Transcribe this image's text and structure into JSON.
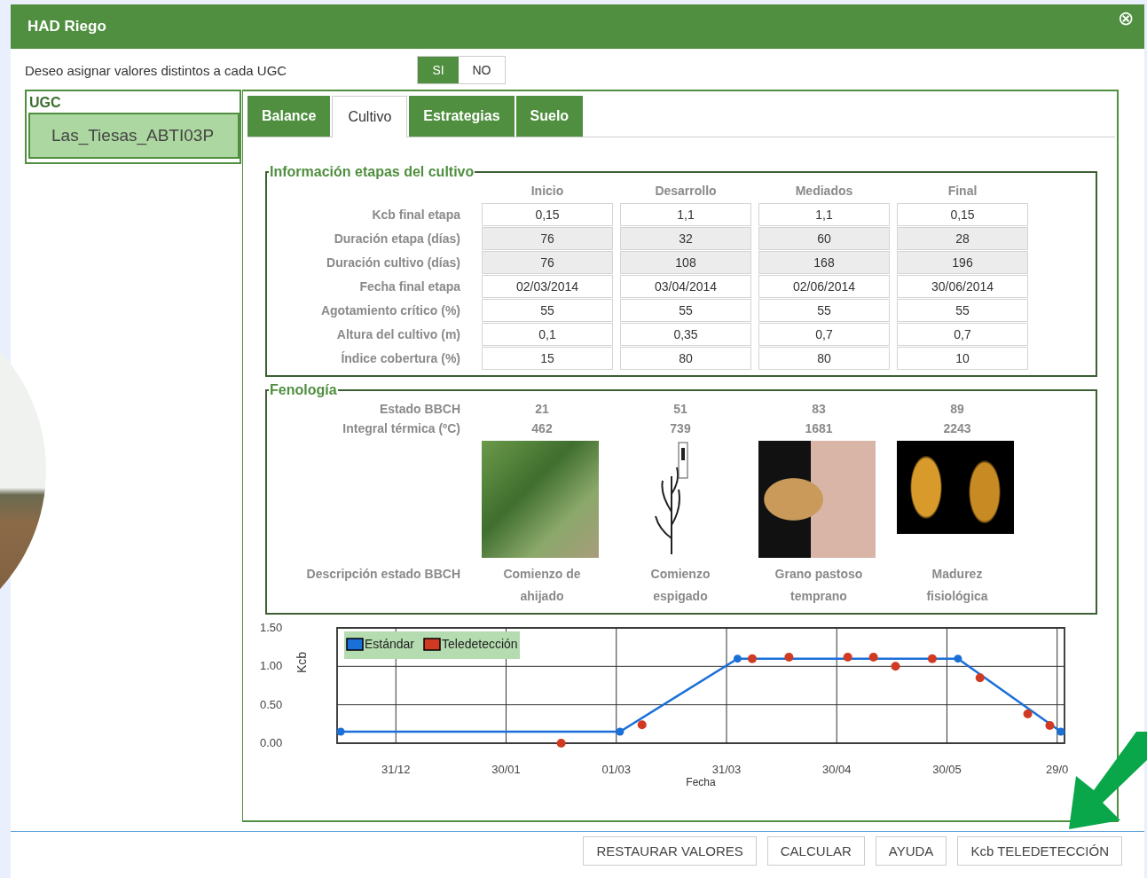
{
  "window": {
    "title": "HAD Riego",
    "close": "⊗"
  },
  "assign": {
    "label": "Deseo asignar valores distintos a cada UGC",
    "options": [
      {
        "label": "SI",
        "selected": true
      },
      {
        "label": "NO",
        "selected": false
      }
    ]
  },
  "ugc": {
    "title": "UGC",
    "items": [
      {
        "label": "Las_Tiesas_ABTI03P",
        "selected": true
      }
    ]
  },
  "tabs": [
    {
      "label": "Balance",
      "selected": false
    },
    {
      "label": "Cultivo",
      "selected": true
    },
    {
      "label": "Estrategias",
      "selected": false
    },
    {
      "label": "Suelo",
      "selected": false
    }
  ],
  "stages": {
    "title": "Información etapas del cultivo",
    "columns": [
      "Inicio",
      "Desarrollo",
      "Mediados",
      "Final"
    ],
    "rows": [
      {
        "label": "Kcb final etapa",
        "disabled": false,
        "values": [
          "0,15",
          "1,1",
          "1,1",
          "0,15"
        ]
      },
      {
        "label": "Duración etapa (días)",
        "disabled": true,
        "values": [
          "76",
          "32",
          "60",
          "28"
        ]
      },
      {
        "label": "Duración cultivo (días)",
        "disabled": true,
        "values": [
          "76",
          "108",
          "168",
          "196"
        ]
      },
      {
        "label": "Fecha final etapa",
        "disabled": false,
        "values": [
          "02/03/2014",
          "03/04/2014",
          "02/06/2014",
          "30/06/2014"
        ]
      },
      {
        "label": "Agotamiento crítico (%)",
        "disabled": false,
        "values": [
          "55",
          "55",
          "55",
          "55"
        ]
      },
      {
        "label": "Altura del cultivo (m)",
        "disabled": false,
        "values": [
          "0,1",
          "0,35",
          "0,7",
          "0,7"
        ]
      },
      {
        "label": "Índice cobertura (%)",
        "disabled": false,
        "values": [
          "15",
          "80",
          "80",
          "10"
        ]
      }
    ]
  },
  "phenology": {
    "title": "Fenología",
    "bbch_label": "Estado BBCH",
    "thermal_label": "Integral térmica (ºC)",
    "description_label": "Descripción estado BBCH",
    "stages": [
      {
        "bbch": "21",
        "thermal": "462",
        "kind": "grass",
        "description": "Comienzo de ahijado"
      },
      {
        "bbch": "51",
        "thermal": "739",
        "kind": "plant",
        "description": "Comienzo espigado"
      },
      {
        "bbch": "83",
        "thermal": "1681",
        "kind": "grain-closeup",
        "description": "Grano pastoso temprano"
      },
      {
        "bbch": "89",
        "thermal": "2243",
        "kind": "grains",
        "description": "Madurez fisiológica"
      }
    ]
  },
  "chart": {
    "chart_data": {
      "type": "line",
      "grid": true,
      "legend": "upper left",
      "xlabel": "Fecha",
      "ylabel": "Kcb",
      "x": [
        "2013-12-16",
        "2014-02-14",
        "2014-03-02",
        "2014-03-08",
        "2014-04-03",
        "2014-04-07",
        "2014-04-17",
        "2014-05-03",
        "2014-05-10",
        "2014-05-16",
        "2014-05-26",
        "2014-06-02",
        "2014-06-08",
        "2014-06-21",
        "2014-06-27",
        "2014-06-30"
      ],
      "series": [
        {
          "name": "Estándar",
          "type": "line",
          "marker": "circle",
          "color": "#1a6fd8",
          "values": [
            0.15,
            null,
            0.15,
            null,
            1.1,
            null,
            null,
            null,
            null,
            null,
            null,
            1.1,
            null,
            null,
            null,
            0.15
          ]
        },
        {
          "name": "Teledetección",
          "type": "scatter",
          "marker": "circle",
          "color": "#d03a22",
          "values": [
            null,
            0,
            null,
            0.24,
            null,
            1.1,
            1.12,
            1.12,
            1.12,
            1.0,
            1.1,
            null,
            0.85,
            0.38,
            0.23,
            null
          ]
        }
      ],
      "xlim": [
        "2013-12-15",
        "2014-07-01"
      ],
      "ylim": [
        0,
        1.5
      ],
      "xticks": [
        {
          "value": "2013-12-31",
          "label": "31/12"
        },
        {
          "value": "2014-01-30",
          "label": "30/01"
        },
        {
          "value": "2014-03-01",
          "label": "01/03"
        },
        {
          "value": "2014-03-31",
          "label": "31/03"
        },
        {
          "value": "2014-04-30",
          "label": "30/04"
        },
        {
          "value": "2014-05-30",
          "label": "30/05"
        },
        {
          "value": "2014-06-29",
          "label": "29/0"
        }
      ],
      "yticks": [
        {
          "value": 0,
          "label": "0.00"
        },
        {
          "value": 0.5,
          "label": "0.50"
        },
        {
          "value": 1,
          "label": "1.00"
        },
        {
          "value": 1.5,
          "label": "1.50"
        }
      ]
    }
  },
  "buttons": [
    "RESTAURAR VALORES",
    "CALCULAR",
    "AYUDA",
    "Kcb TELEDETECCIÓN"
  ]
}
